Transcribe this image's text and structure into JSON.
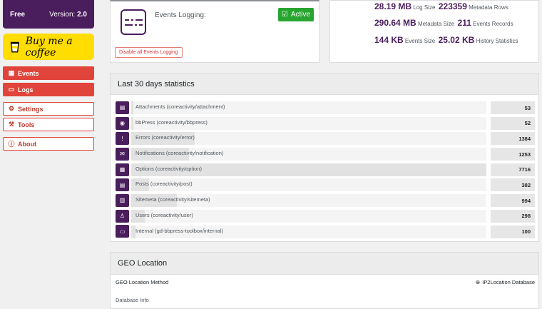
{
  "sidebar": {
    "edition": "Free",
    "version_label": "Version:",
    "version_value": "2.0",
    "coffee_label": "Buy me a coffee",
    "nav": [
      {
        "label": "Events",
        "icon": "calendar-icon",
        "active": true
      },
      {
        "label": "Logs",
        "icon": "folder-icon",
        "active": true
      },
      {
        "label": "Settings",
        "icon": "gear-icon",
        "active": false
      },
      {
        "label": "Tools",
        "icon": "wrench-icon",
        "active": false
      },
      {
        "label": "About",
        "icon": "info-icon",
        "active": false
      }
    ]
  },
  "logging": {
    "label": "Events Logging:",
    "status": "Active",
    "disable_button": "Disable all Events Logging"
  },
  "summary": [
    {
      "v1": "28.19 MB",
      "t1": "Log Size",
      "v2": "223359",
      "t2": "Metadata Rows"
    },
    {
      "v1": "290.64 MB",
      "t1": "Metadata Size",
      "v2": "211",
      "t2": "Events Records"
    },
    {
      "v1": "144 KB",
      "t1": "Events Size",
      "v2": "25.02 KB",
      "t2": "History Statistics"
    }
  ],
  "stats": {
    "title": "Last 30 days statistics",
    "rows": [
      {
        "label": "Attachments (coreactivity/attachment)",
        "value": "53",
        "count": 53,
        "icon": "attachment-icon",
        "glyph": "▤"
      },
      {
        "label": "bbPress (coreactivity/bbpress)",
        "value": "52",
        "count": 52,
        "icon": "bbpress-icon",
        "glyph": "◉"
      },
      {
        "label": "Errors (coreactivity/error)",
        "value": "1384",
        "count": 1384,
        "icon": "error-icon",
        "glyph": "!"
      },
      {
        "label": "Notifications (coreactivity/notification)",
        "value": "1253",
        "count": 1253,
        "icon": "mail-icon",
        "glyph": "✉"
      },
      {
        "label": "Options (coreactivity/option)",
        "value": "7716",
        "count": 7716,
        "icon": "options-icon",
        "glyph": "▦"
      },
      {
        "label": "Posts (coreactivity/post)",
        "value": "382",
        "count": 382,
        "icon": "post-icon",
        "glyph": "▤"
      },
      {
        "label": "Sitemeta (coreactivity/sitemeta)",
        "value": "994",
        "count": 994,
        "icon": "sitemeta-icon",
        "glyph": "▥"
      },
      {
        "label": "Users (coreactivity/user)",
        "value": "298",
        "count": 298,
        "icon": "user-icon",
        "glyph": "♙"
      },
      {
        "label": "Internal (gd-bbpress-toolbox/internal)",
        "value": "100",
        "count": 100,
        "icon": "folder-icon",
        "glyph": "▭"
      }
    ]
  },
  "geo": {
    "title": "GEO Location",
    "method_label": "GEO Location Method",
    "method_value": "IP2Location Database",
    "next_row_label": "Database Info"
  },
  "colors": {
    "brand": "#4a1d5c",
    "danger": "#e0443a",
    "success": "#27a530",
    "coffee": "#ffdd00"
  }
}
